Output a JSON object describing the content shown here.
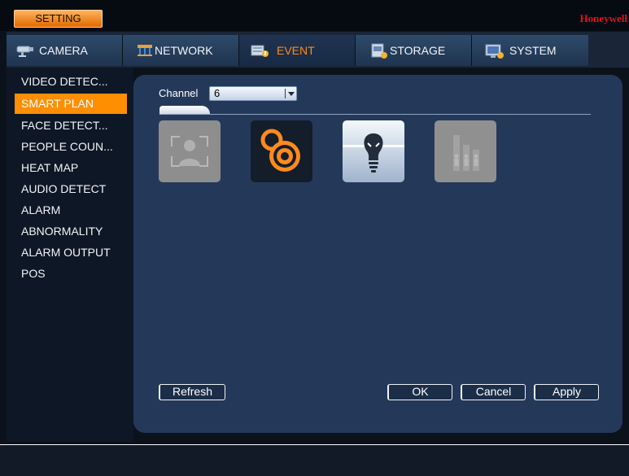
{
  "window": {
    "setting_label": "SETTING",
    "brand": "Honeywell",
    "accent_color": "#ff8f00",
    "brand_color": "#e2101a"
  },
  "tabs": [
    {
      "label": "CAMERA",
      "icon": "camera-icon"
    },
    {
      "label": "NETWORK",
      "icon": "network-icon"
    },
    {
      "label": "EVENT",
      "icon": "event-icon",
      "active": true
    },
    {
      "label": "STORAGE",
      "icon": "storage-icon"
    },
    {
      "label": "SYSTEM",
      "icon": "system-icon"
    }
  ],
  "sidebar": {
    "items": [
      {
        "label": "VIDEO DETEC..."
      },
      {
        "label": "SMART PLAN",
        "active": true
      },
      {
        "label": "FACE DETECT..."
      },
      {
        "label": "PEOPLE COUN..."
      },
      {
        "label": "HEAT MAP"
      },
      {
        "label": "AUDIO DETECT"
      },
      {
        "label": "ALARM"
      },
      {
        "label": "ABNORMALITY"
      },
      {
        "label": "ALARM OUTPUT"
      },
      {
        "label": "POS"
      }
    ]
  },
  "main": {
    "channel_label": "Channel",
    "channel_value": "6",
    "plans": [
      {
        "icon": "face-detection-icon",
        "state": "disabled"
      },
      {
        "icon": "ivs-target-icon",
        "state": "enabled"
      },
      {
        "icon": "lightbulb-icon",
        "state": "selected"
      },
      {
        "icon": "people-counting-icon",
        "state": "disabled"
      }
    ]
  },
  "buttons": {
    "refresh": "Refresh",
    "ok": "OK",
    "cancel": "Cancel",
    "apply": "Apply"
  }
}
